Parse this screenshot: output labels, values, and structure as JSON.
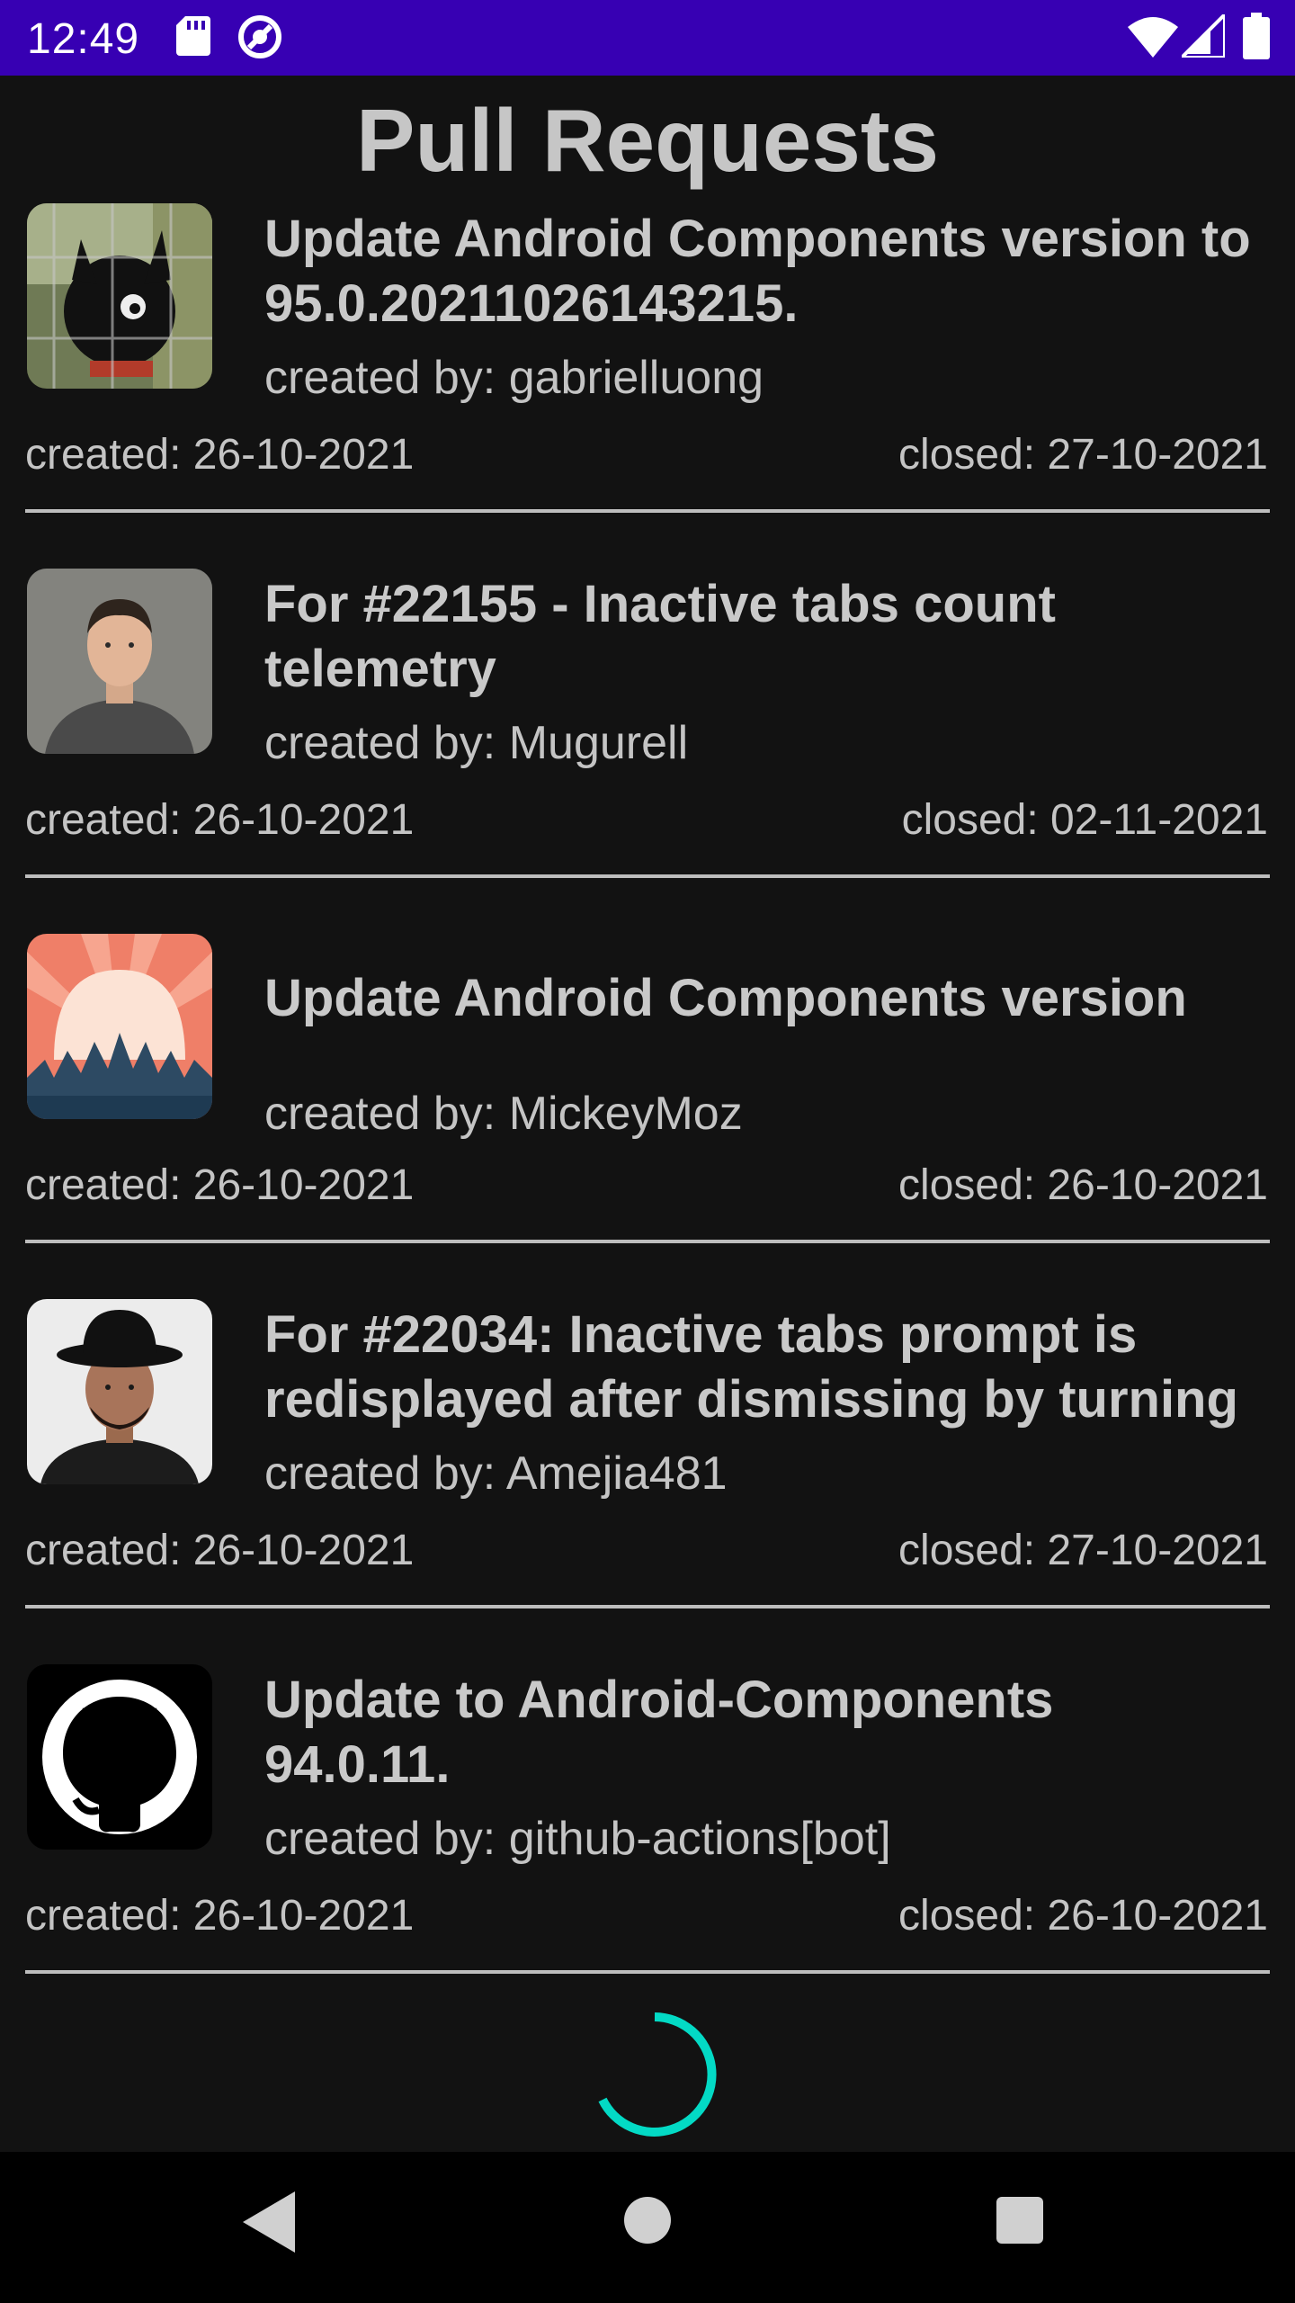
{
  "status_bar": {
    "time": "12:49",
    "icons": [
      "sd-card-icon",
      "sync-icon",
      "wifi-icon",
      "signal-icon",
      "battery-icon"
    ],
    "background": "#3700b3"
  },
  "page": {
    "title": "Pull Requests"
  },
  "pull_requests": [
    {
      "title": "Update Android Components version to\n95.0.20211026143215.",
      "author": "created by: gabrielluong",
      "created": "created: 26-10-2021",
      "closed": "closed: 27-10-2021",
      "avatar": "plush-toy-avatar"
    },
    {
      "title": "For #22155 - Inactive tabs count\ntelemetry",
      "author": "created by: Mugurell",
      "created": "created: 26-10-2021",
      "closed": "closed: 02-11-2021",
      "avatar": "man-portrait-avatar"
    },
    {
      "title": "Update Android Components version",
      "author": "created by: MickeyMoz",
      "created": "created: 26-10-2021",
      "closed": "closed: 26-10-2021",
      "avatar": "crowd-illustration-avatar"
    },
    {
      "title": "For #22034: Inactive tabs prompt is\nredisplayed after dismissing by turning",
      "author": "created by: Amejia481",
      "created": "created: 26-10-2021",
      "closed": "closed: 27-10-2021",
      "avatar": "man-with-hat-avatar"
    },
    {
      "title": "Update to Android-Components\n94.0.11.",
      "author": "created by: github-actions[bot]",
      "created": "created: 26-10-2021",
      "closed": "closed: 26-10-2021",
      "avatar": "github-octocat-avatar"
    }
  ],
  "loading": {
    "spinner_color": "#03dac5"
  },
  "nav_bar": {
    "buttons": [
      "back-icon",
      "home-icon",
      "recents-icon"
    ]
  }
}
